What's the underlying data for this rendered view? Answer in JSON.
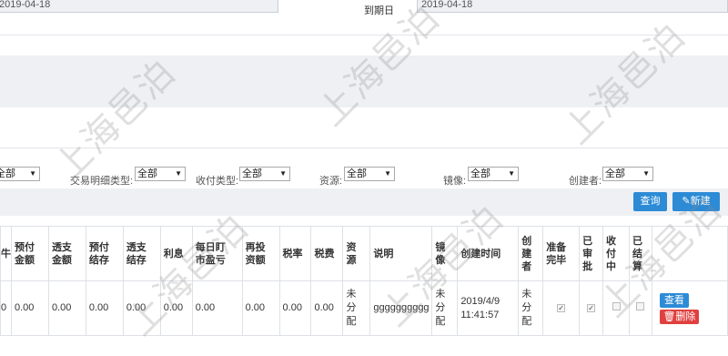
{
  "top_fields": {
    "left_date_value": "2019-04-18",
    "due_date_label": "到期日",
    "due_date_value": "2019-04-18"
  },
  "filters": [
    {
      "label": "",
      "value": "全部"
    },
    {
      "label": "交易明细类型:",
      "value": "全部"
    },
    {
      "label": "收付类型:",
      "value": "全部"
    },
    {
      "label": "资源:",
      "value": "全部"
    },
    {
      "label": "镜像:",
      "value": "全部"
    },
    {
      "label": "创建者:",
      "value": "全部"
    }
  ],
  "toolbar": {
    "query_label": "查询",
    "new_label": "新建",
    "new_icon": "pencil-icon"
  },
  "table": {
    "headers": [
      "",
      "预付\n金额",
      "透支\n金额",
      "预付\n结存",
      "透支\n结存",
      "利息",
      "每日盯\n市盈亏",
      "再投\n资额",
      "税率",
      "税费",
      "资\n源",
      "说明",
      "镜\n像",
      "创建时间",
      "创\n建\n者",
      "准备\n完毕",
      "已\n审\n批",
      "收\n付\n中",
      "已\n结\n算",
      ""
    ],
    "row": {
      "c0": "0",
      "prepaid_amount": "0.00",
      "overdraft_amount": "0.00",
      "prepaid_balance": "0.00",
      "overdraft_balance": "0.00",
      "interest": "0.00",
      "daily_mtm_pnl": "0.00",
      "reinvest_amount": "0.00",
      "tax_rate": "0.00",
      "tax_fee": "0.00",
      "resource": "未\n分\n配",
      "description": "gggggggggg",
      "image": "未\n分\n配",
      "created_time": "2019/4/9\n11:41:57",
      "creator": "未\n分\n配",
      "ready": true,
      "approved": true,
      "collecting": false,
      "settled": false,
      "view_label": "查看",
      "delete_label": "删除"
    }
  },
  "watermark_text": "上海邑泊"
}
